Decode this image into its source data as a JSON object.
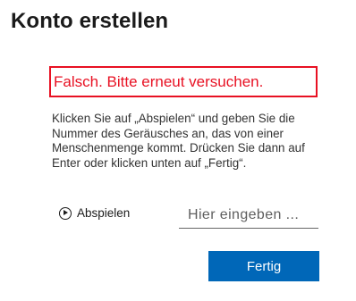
{
  "page": {
    "title": "Konto erstellen"
  },
  "error": {
    "message": "Falsch. Bitte erneut versuchen."
  },
  "challenge": {
    "instructions": "Klicken Sie auf „Abspielen“ und geben Sie die Nummer des Geräusches an, das von einer Menschenmenge kommt. Drücken Sie dann auf Enter oder klicken unten auf „Fertig“.",
    "play_label": "Abspielen",
    "play_icon": "play-circle-icon",
    "input_value": "",
    "input_placeholder": "Hier eingeben ..."
  },
  "actions": {
    "done_label": "Fertig"
  },
  "colors": {
    "error": "#e81123",
    "primary": "#0067b8"
  }
}
